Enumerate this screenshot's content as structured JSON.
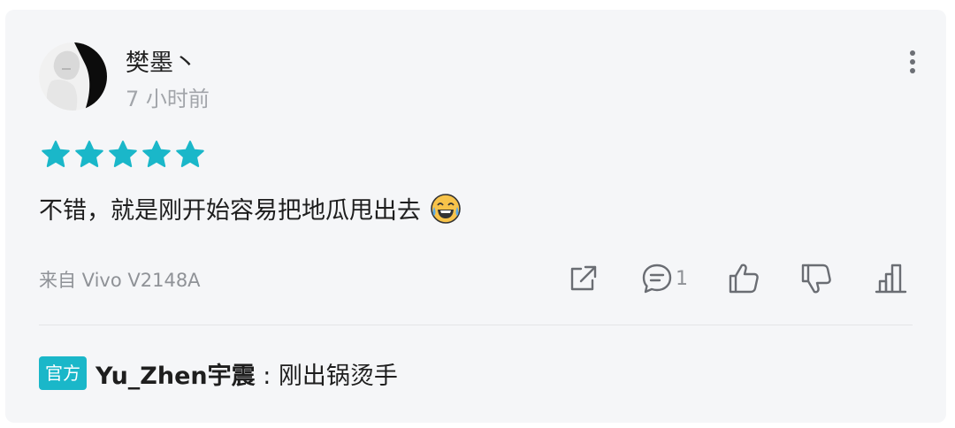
{
  "review": {
    "username": "樊墨丶",
    "time": "7 小时前",
    "rating": 5,
    "rating_max": 5,
    "text": "不错，就是刚开始容易把地瓜甩出去",
    "device": "来自 Vivo V2148A"
  },
  "actions": {
    "comment_count": "1"
  },
  "official_reply": {
    "badge": "官方",
    "author": "Yu_Zhen宇震",
    "separator": " : ",
    "text": "刚出锅烫手"
  },
  "colors": {
    "accent": "#1ab7c9",
    "star": "#1ab7c9",
    "text": "#1e1e1e",
    "muted": "#8f9297"
  },
  "icons": [
    "more-vertical-icon",
    "share-icon",
    "comment-icon",
    "thumbs-up-icon",
    "thumbs-down-icon",
    "chart-icon",
    "laughing-emoji-icon"
  ]
}
